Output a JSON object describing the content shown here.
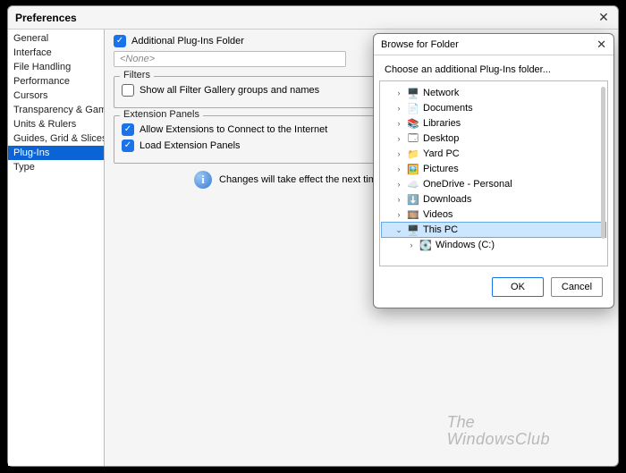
{
  "main": {
    "title": "Preferences",
    "top_button_label": ""
  },
  "sidebar": {
    "items": [
      {
        "label": "General"
      },
      {
        "label": "Interface"
      },
      {
        "label": "File Handling"
      },
      {
        "label": "Performance"
      },
      {
        "label": "Cursors"
      },
      {
        "label": "Transparency & Gamut"
      },
      {
        "label": "Units & Rulers"
      },
      {
        "label": "Guides, Grid & Slices"
      },
      {
        "label": "Plug-Ins"
      },
      {
        "label": "Type"
      }
    ],
    "selected_index": 8
  },
  "additional_folder": {
    "checkbox_label": "Additional Plug-Ins Folder",
    "checked": true,
    "placeholder": "<None>"
  },
  "filters": {
    "legend": "Filters",
    "option_label": "Show all Filter Gallery groups and names",
    "checked": false
  },
  "extension_panels": {
    "legend": "Extension Panels",
    "allow_label": "Allow Extensions to Connect to the Internet",
    "allow_checked": true,
    "load_label": "Load Extension Panels",
    "load_checked": true
  },
  "info_note": "Changes will take effect the next time yo",
  "browse": {
    "title": "Browse for Folder",
    "subtitle": "Choose an additional Plug-Ins folder...",
    "tree": [
      {
        "label": "Network",
        "icon": "🖥️",
        "expand": "right",
        "indent": 1
      },
      {
        "label": "Documents",
        "icon": "📄",
        "expand": "right",
        "indent": 1
      },
      {
        "label": "Libraries",
        "icon": "📚",
        "expand": "right",
        "indent": 1
      },
      {
        "label": "Desktop",
        "icon": "🗔",
        "expand": "right",
        "indent": 1
      },
      {
        "label": "Yard PC",
        "icon": "📁",
        "expand": "right",
        "indent": 1
      },
      {
        "label": "Pictures",
        "icon": "🖼️",
        "expand": "right",
        "indent": 1
      },
      {
        "label": "OneDrive - Personal",
        "icon": "☁️",
        "expand": "right",
        "indent": 1
      },
      {
        "label": "Downloads",
        "icon": "⬇️",
        "expand": "right",
        "indent": 1
      },
      {
        "label": "Videos",
        "icon": "🎞️",
        "expand": "right",
        "indent": 1
      },
      {
        "label": "This PC",
        "icon": "🖥️",
        "expand": "down",
        "indent": 1,
        "selected": true
      },
      {
        "label": "Windows (C:)",
        "icon": "💽",
        "expand": "right",
        "indent": 2
      }
    ],
    "ok_label": "OK",
    "cancel_label": "Cancel"
  },
  "watermark": {
    "line1": "The",
    "line2": "WindowsClub"
  }
}
